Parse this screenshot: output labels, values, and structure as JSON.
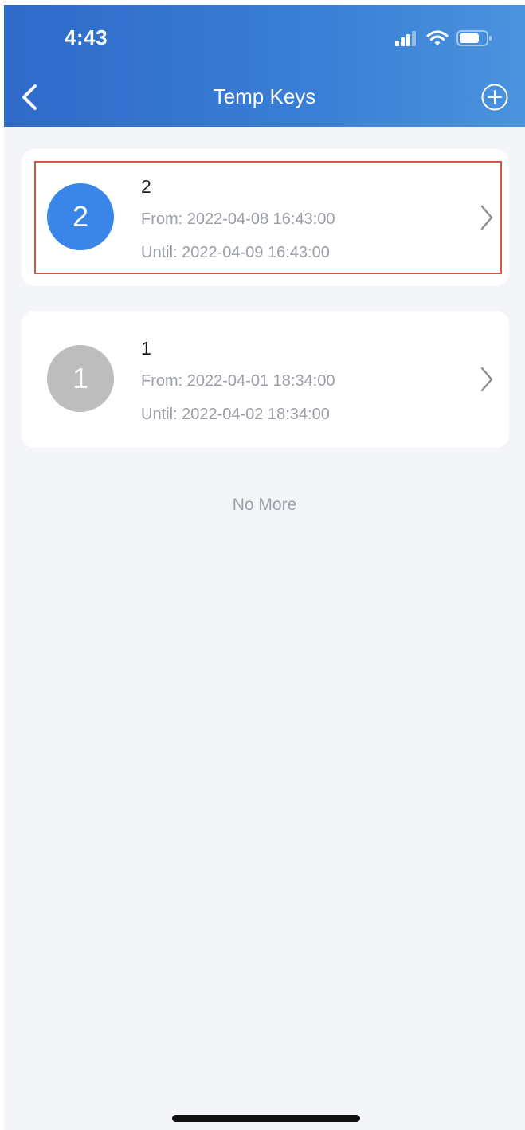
{
  "status_bar": {
    "time": "4:43"
  },
  "nav": {
    "title": "Temp Keys"
  },
  "keys": [
    {
      "avatar": "2",
      "name": "2",
      "from": "From: 2022-04-08 16:43:00",
      "until": "Until: 2022-04-09 16:43:00",
      "avatar_color": "#3a86e8",
      "selected": true
    },
    {
      "avatar": "1",
      "name": "1",
      "from": "From: 2022-04-01 18:34:00",
      "until": "Until: 2022-04-02 18:34:00",
      "avatar_color": "#bdbdbd",
      "selected": false
    }
  ],
  "list_footer": "No More",
  "colors": {
    "header": "#3577d0",
    "background": "#f3f5f9",
    "highlight": "#d2593f"
  },
  "icons": {
    "back": "chevron-left-icon",
    "add": "plus-circle-icon",
    "row_arrow": "chevron-right-icon",
    "signal": "cellular-signal-icon",
    "wifi": "wifi-icon",
    "battery": "battery-icon"
  }
}
